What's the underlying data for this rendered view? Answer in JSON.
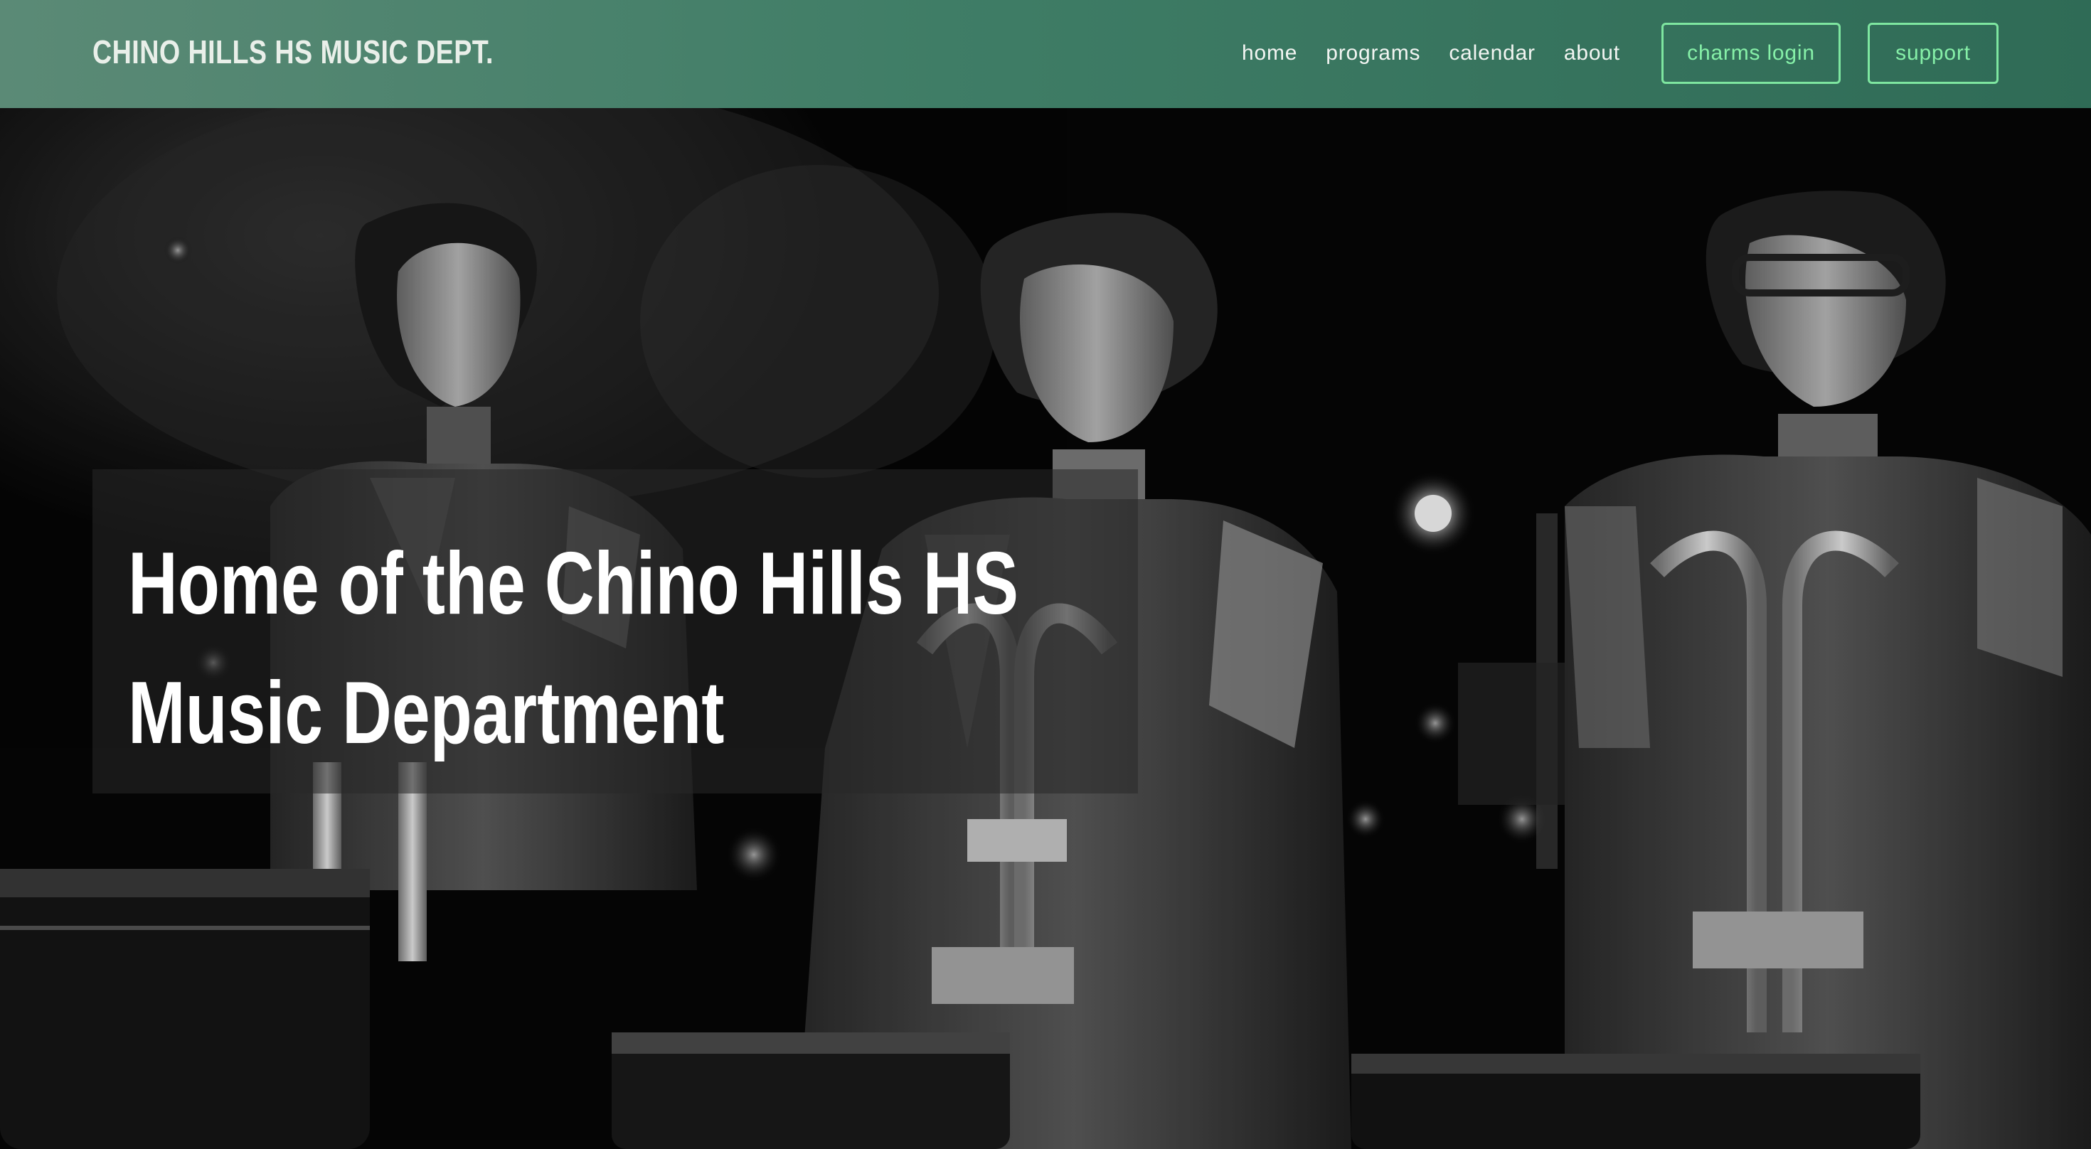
{
  "brand": {
    "title": "CHINO HILLS HS MUSIC DEPT."
  },
  "nav": {
    "links": [
      {
        "label": "home"
      },
      {
        "label": "programs"
      },
      {
        "label": "calendar"
      },
      {
        "label": "about"
      }
    ],
    "charms_button": "charms login",
    "support_button": "support"
  },
  "hero": {
    "headline_line1": "Home of the Chino Hills HS",
    "headline_line2": "Music Department",
    "image_subject": "drumline-photo"
  },
  "colors": {
    "nav_gradient_start": "#5b8a76",
    "nav_gradient_end": "#2f6b56",
    "accent_green": "#86f0a8",
    "headline_text": "#ffffff"
  }
}
